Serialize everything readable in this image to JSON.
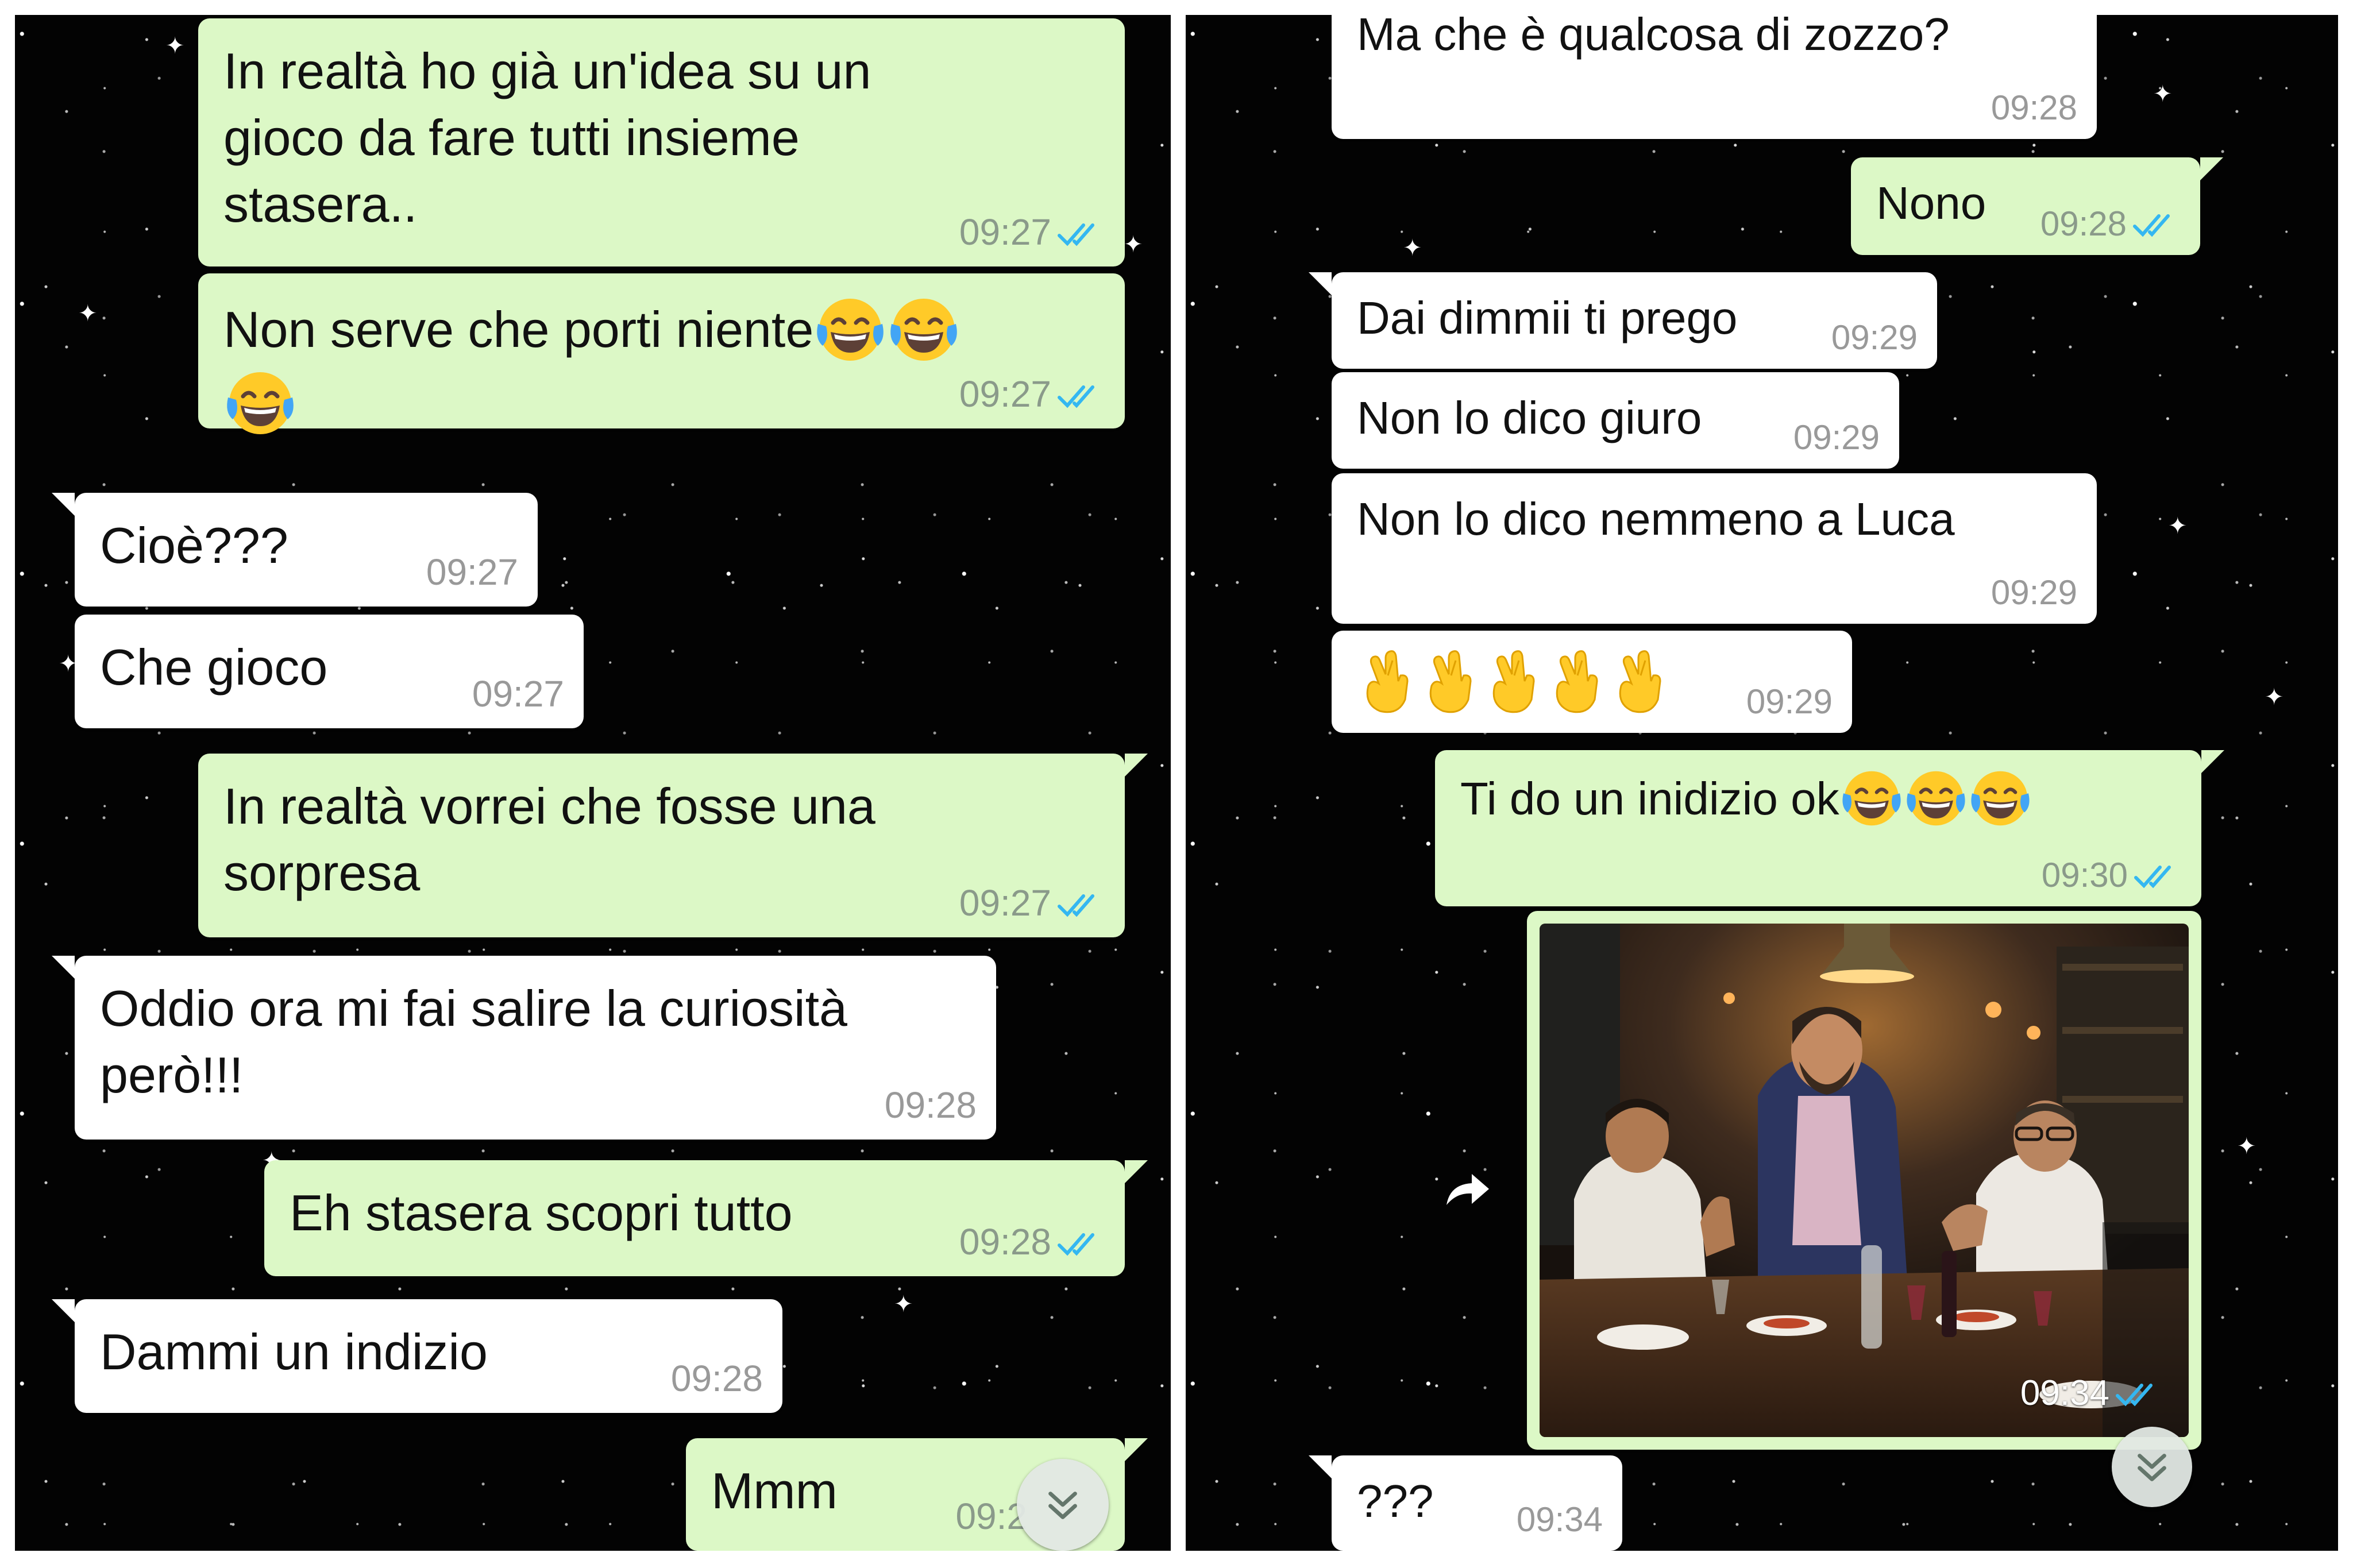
{
  "left": {
    "messages": [
      {
        "dir": "out",
        "text": "In realtà ho già un'idea su un\ngioco da fare tutti insieme\nstasera..",
        "time": "09:27",
        "status": "read"
      },
      {
        "dir": "out",
        "text": "Non serve che porti niente",
        "emoji": "face-with-tears-of-joy x3",
        "time": "09:27",
        "status": "read"
      },
      {
        "dir": "in",
        "text": "Cioè???",
        "time": "09:27"
      },
      {
        "dir": "in",
        "text": "Che gioco",
        "time": "09:27"
      },
      {
        "dir": "out",
        "text": "In realtà vorrei che fosse una\nsorpresa",
        "time": "09:27",
        "status": "read"
      },
      {
        "dir": "in",
        "text": "Oddio ora mi fai salire la curiosità\nperò!!!",
        "time": "09:28"
      },
      {
        "dir": "out",
        "text": "Eh stasera scopri tutto",
        "time": "09:28",
        "status": "read"
      },
      {
        "dir": "in",
        "text": "Dammi un indizio",
        "time": "09:28"
      },
      {
        "dir": "out",
        "text": "Mmm",
        "time": "09:2",
        "status": "read"
      }
    ]
  },
  "right": {
    "messages": [
      {
        "dir": "in",
        "text": "Ma che è qualcosa di zozzo?",
        "time": "09:28"
      },
      {
        "dir": "out",
        "text": "Nono",
        "time": "09:28",
        "status": "read"
      },
      {
        "dir": "in",
        "text": "Dai dimmii ti prego",
        "time": "09:29"
      },
      {
        "dir": "in",
        "text": "Non lo dico giuro",
        "time": "09:29"
      },
      {
        "dir": "in",
        "text": "Non lo dico nemmeno a Luca",
        "time": "09:29"
      },
      {
        "dir": "in",
        "emoji": "crossed-fingers x5",
        "time": "09:29"
      },
      {
        "dir": "out",
        "text": "Ti do un inidizio ok",
        "emoji": "face-with-tears-of-joy x3",
        "time": "09:30",
        "status": "read"
      },
      {
        "dir": "out",
        "type": "image",
        "image": "dinner-table-photo",
        "time": "09:34",
        "status": "read"
      },
      {
        "dir": "in",
        "text": "???",
        "time": "09:34"
      }
    ]
  },
  "icons": {
    "read_receipt": "double-check-icon",
    "scroll_down": "chevron-double-down-icon",
    "forward": "forward-arrow-icon"
  },
  "colors": {
    "outgoing_bubble": "#dcf8c6",
    "incoming_bubble": "#ffffff",
    "chat_background": "#030303",
    "read_ticks": "#34b7f1",
    "timestamp": "#8a9a8a"
  }
}
